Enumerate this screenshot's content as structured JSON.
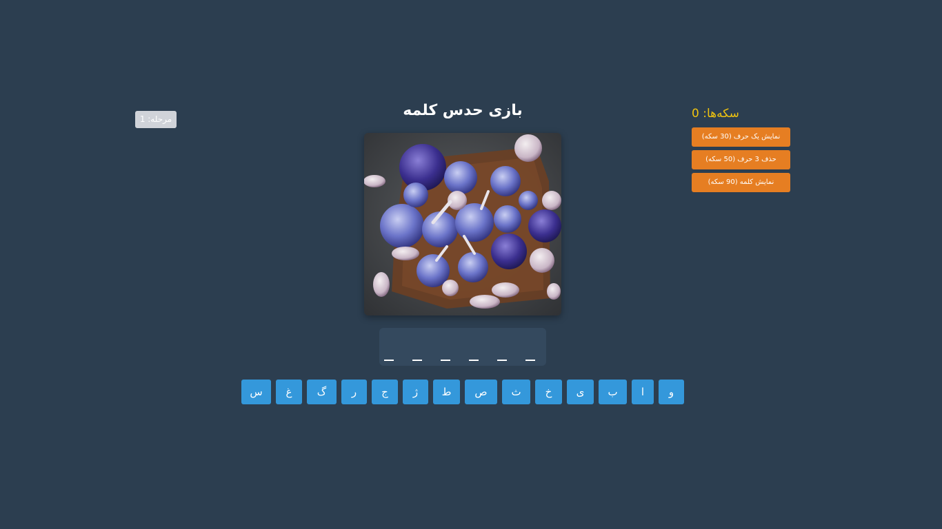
{
  "game": {
    "title": "بازی حدس کلمه",
    "level_text": "مرحله: 1",
    "coins_label": "سکه‌ها: 0"
  },
  "hints": [
    {
      "label": "نمایش یک حرف (30 سکه)"
    },
    {
      "label": "حذف 3 حرف (50 سکه)"
    },
    {
      "label": "نمایش کلمه (90 سکه)"
    }
  ],
  "answer": {
    "length": 6,
    "slots": [
      "",
      "",
      "",
      "",
      "",
      ""
    ]
  },
  "letters": [
    "س",
    "غ",
    "گ",
    "ر",
    "ج",
    "ژ",
    "ط",
    "ص",
    "ث",
    "خ",
    "ی",
    "ب",
    "ا",
    "و"
  ],
  "image": {
    "subject": "garlic-bulbs"
  },
  "colors": {
    "background": "#2c3e50",
    "answer_box": "#34495e",
    "hint_button": "#e67e22",
    "letter_button": "#3498db",
    "coins_text": "#f1c40f",
    "level_badge": "#d0d3d9"
  }
}
